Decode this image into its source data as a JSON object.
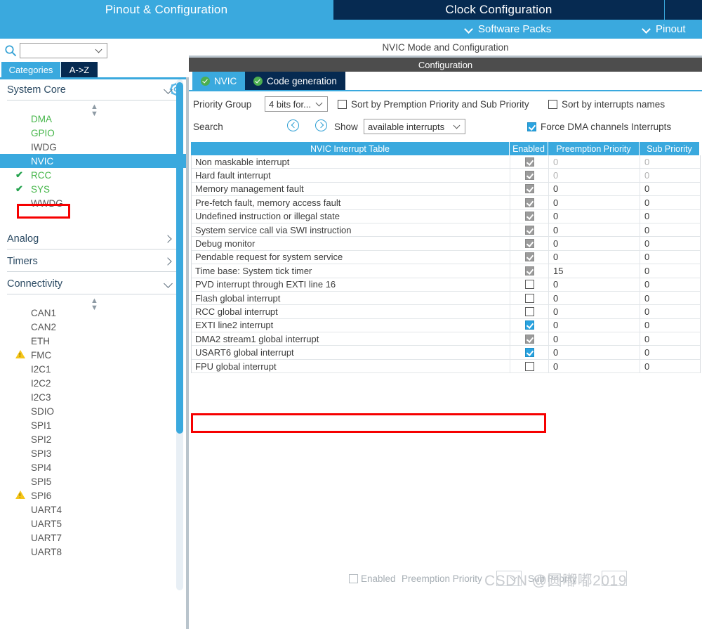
{
  "top_tabs": [
    {
      "label": "Pinout & Configuration",
      "active": true
    },
    {
      "label": "Clock Configuration",
      "active": false
    },
    {
      "label": "",
      "active": false
    }
  ],
  "menu_bar": {
    "software_packs": "Software Packs",
    "pinout": "Pinout",
    "chevron_icon": "chevron-down-icon"
  },
  "left_panel": {
    "search": {
      "value": "",
      "placeholder": ""
    },
    "search_icon": "search-icon",
    "gear_icon": "gear-icon",
    "tabs": [
      {
        "label": "Categories",
        "active": true
      },
      {
        "label": "A->Z",
        "active": false
      }
    ],
    "sections": [
      {
        "title": "System Core",
        "expanded": true,
        "items": [
          {
            "label": "DMA",
            "state": "configured",
            "mark": ""
          },
          {
            "label": "GPIO",
            "state": "configured",
            "mark": ""
          },
          {
            "label": "IWDG",
            "state": "none",
            "mark": ""
          },
          {
            "label": "NVIC",
            "state": "selected",
            "mark": ""
          },
          {
            "label": "RCC",
            "state": "configured",
            "mark": "check"
          },
          {
            "label": "SYS",
            "state": "configured",
            "mark": "check"
          },
          {
            "label": "WWDG",
            "state": "none",
            "mark": ""
          }
        ]
      },
      {
        "title": "Analog",
        "expanded": false,
        "items": []
      },
      {
        "title": "Timers",
        "expanded": false,
        "items": []
      },
      {
        "title": "Connectivity",
        "expanded": true,
        "items": [
          {
            "label": "CAN1",
            "state": "none",
            "mark": ""
          },
          {
            "label": "CAN2",
            "state": "none",
            "mark": ""
          },
          {
            "label": "ETH",
            "state": "none",
            "mark": ""
          },
          {
            "label": "FMC",
            "state": "none",
            "mark": "warn"
          },
          {
            "label": "I2C1",
            "state": "none",
            "mark": ""
          },
          {
            "label": "I2C2",
            "state": "none",
            "mark": ""
          },
          {
            "label": "I2C3",
            "state": "none",
            "mark": ""
          },
          {
            "label": "SDIO",
            "state": "none",
            "mark": ""
          },
          {
            "label": "SPI1",
            "state": "none",
            "mark": ""
          },
          {
            "label": "SPI2",
            "state": "none",
            "mark": ""
          },
          {
            "label": "SPI3",
            "state": "none",
            "mark": ""
          },
          {
            "label": "SPI4",
            "state": "none",
            "mark": ""
          },
          {
            "label": "SPI5",
            "state": "none",
            "mark": ""
          },
          {
            "label": "SPI6",
            "state": "none",
            "mark": "warn"
          },
          {
            "label": "UART4",
            "state": "none",
            "mark": ""
          },
          {
            "label": "UART5",
            "state": "none",
            "mark": ""
          },
          {
            "label": "UART7",
            "state": "none",
            "mark": ""
          },
          {
            "label": "UART8",
            "state": "none",
            "mark": ""
          }
        ]
      }
    ]
  },
  "main": {
    "mode_title": "NVIC Mode and Configuration",
    "config_title": "Configuration",
    "subtabs": [
      {
        "label": "NVIC",
        "active": true,
        "icon": "check-circle-icon"
      },
      {
        "label": "Code generation",
        "active": false,
        "icon": "check-circle-icon"
      }
    ],
    "options": {
      "priority_group_label": "Priority Group",
      "priority_group_value": "4 bits for...",
      "sort_by_preemption_label": "Sort by Premption Priority and Sub Priority",
      "sort_by_preemption_checked": false,
      "sort_by_names_label": "Sort by interrupts names",
      "sort_by_names_checked": false,
      "search_label": "Search",
      "prev_icon": "arrow-left-circle-icon",
      "next_icon": "arrow-right-circle-icon",
      "show_label": "Show",
      "show_value": "available interrupts",
      "force_dma_label": "Force DMA channels Interrupts",
      "force_dma_checked": true
    },
    "table": {
      "headers": [
        "NVIC Interrupt Table",
        "Enabled",
        "Preemption Priority",
        "Sub Priority"
      ],
      "rows": [
        {
          "name": "Non maskable interrupt",
          "enabled": "readonly",
          "pre": "0",
          "sub": "0",
          "dim": true,
          "highlight": false
        },
        {
          "name": "Hard fault interrupt",
          "enabled": "readonly",
          "pre": "0",
          "sub": "0",
          "dim": true,
          "highlight": false
        },
        {
          "name": "Memory management fault",
          "enabled": "readonly",
          "pre": "0",
          "sub": "0",
          "dim": false,
          "highlight": false
        },
        {
          "name": "Pre-fetch fault, memory access fault",
          "enabled": "readonly",
          "pre": "0",
          "sub": "0",
          "dim": false,
          "highlight": false
        },
        {
          "name": "Undefined instruction or illegal state",
          "enabled": "readonly",
          "pre": "0",
          "sub": "0",
          "dim": false,
          "highlight": false
        },
        {
          "name": "System service call via SWI instruction",
          "enabled": "readonly",
          "pre": "0",
          "sub": "0",
          "dim": false,
          "highlight": false
        },
        {
          "name": "Debug monitor",
          "enabled": "readonly",
          "pre": "0",
          "sub": "0",
          "dim": false,
          "highlight": false
        },
        {
          "name": "Pendable request for system service",
          "enabled": "readonly",
          "pre": "0",
          "sub": "0",
          "dim": false,
          "highlight": false
        },
        {
          "name": "Time base: System tick timer",
          "enabled": "readonly",
          "pre": "15",
          "sub": "0",
          "dim": false,
          "highlight": false
        },
        {
          "name": "PVD interrupt through EXTI line 16",
          "enabled": "off",
          "pre": "0",
          "sub": "0",
          "dim": false,
          "highlight": false
        },
        {
          "name": "Flash global interrupt",
          "enabled": "off",
          "pre": "0",
          "sub": "0",
          "dim": false,
          "highlight": false
        },
        {
          "name": "RCC global interrupt",
          "enabled": "off",
          "pre": "0",
          "sub": "0",
          "dim": false,
          "highlight": false
        },
        {
          "name": "EXTI line2 interrupt",
          "enabled": "on",
          "pre": "0",
          "sub": "0",
          "dim": false,
          "highlight": false
        },
        {
          "name": "DMA2 stream1 global interrupt",
          "enabled": "readonly",
          "pre": "0",
          "sub": "0",
          "dim": false,
          "highlight": false
        },
        {
          "name": "USART6 global interrupt",
          "enabled": "on",
          "pre": "0",
          "sub": "0",
          "dim": false,
          "highlight": true
        },
        {
          "name": "FPU global interrupt",
          "enabled": "off",
          "pre": "0",
          "sub": "0",
          "dim": false,
          "highlight": false
        }
      ]
    },
    "bottom": {
      "enabled_label": "Enabled",
      "enabled_checked": false,
      "preemption_label": "Preemption Priority",
      "preemption_value": "",
      "sub_label": "Sub Priority",
      "sub_value": ""
    }
  },
  "watermark": "CSDN @圆嘟嘟2019",
  "colors": {
    "accent_blue": "#3aa9de",
    "dark_navy": "#062a51",
    "highlight_red": "#f60000",
    "green_text": "#45b649",
    "warn_yellow": "#f5c518"
  }
}
